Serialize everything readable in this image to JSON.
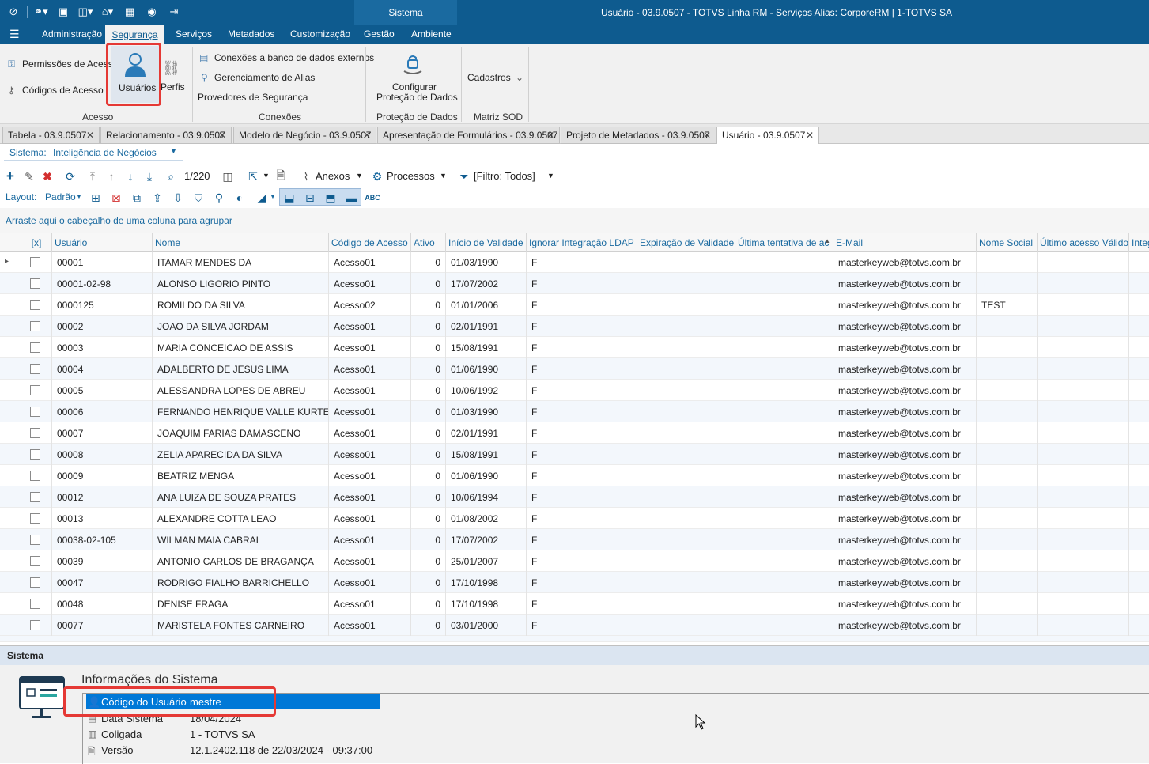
{
  "titlebar": {
    "system_tab": "Sistema",
    "window_title": "Usuário - 03.9.0507 - TOTVS Linha RM - Serviços  Alias: CorporeRM | 1-TOTVS SA"
  },
  "menu": {
    "items": [
      "Administração",
      "Segurança",
      "Serviços",
      "Metadados",
      "Customização",
      "Gestão",
      "Ambiente"
    ],
    "active": "Segurança"
  },
  "ribbon": {
    "permissoes": "Permissões de Acesso",
    "codigos": "Códigos de Acesso",
    "usuarios": "Usuários",
    "perfis": "Perfis",
    "acesso_label": "Acesso",
    "conexoes_bd": "Conexões a banco de dados externos",
    "alias": "Gerenciamento de Alias",
    "provedores": "Provedores de Segurança",
    "conexoes_label": "Conexões",
    "configurar_1": "Configurar",
    "configurar_2": "Proteção de Dados",
    "protecao_label": "Proteção de Dados",
    "cadastros": "Cadastros",
    "matriz_label": "Matriz SOD"
  },
  "doc_tabs": [
    "Tabela - 03.9.0507",
    "Relacionamento - 03.9.0507",
    "Modelo de Negócio - 03.9.0507",
    "Apresentação de Formulários - 03.9.0507",
    "Projeto de Metadados - 03.9.0507",
    "Usuário - 03.9.0507"
  ],
  "sistema": {
    "label": "Sistema:",
    "value": "Inteligência de Negócios"
  },
  "toolbar": {
    "record_count": "1/220",
    "anexos": "Anexos",
    "processos": "Processos",
    "filtro": "[Filtro: Todos]",
    "layout_label": "Layout:",
    "layout_value": "Padrão"
  },
  "group_hint": "Arraste aqui o cabeçalho de uma coluna para agrupar",
  "grid": {
    "headers": [
      "[x]",
      "Usuário",
      "Nome",
      "Código de Acesso",
      "Ativo",
      "Início de Validade",
      "Ignorar Integração LDAP",
      "Expiração de Validade",
      "Última tentativa de ac",
      "E-Mail",
      "Nome Social",
      "Último acesso Válido",
      "Integ"
    ],
    "rows": [
      [
        "00001",
        "ITAMAR MENDES DA",
        "Acesso01",
        "0",
        "01/03/1990",
        "F",
        "masterkeyweb@totvs.com.br",
        ""
      ],
      [
        "00001-02-98",
        "ALONSO LIGORIO PINTO",
        "Acesso01",
        "0",
        "17/07/2002",
        "F",
        "masterkeyweb@totvs.com.br",
        ""
      ],
      [
        "0000125",
        "ROMILDO DA SILVA",
        "Acesso02",
        "0",
        "01/01/2006",
        "F",
        "masterkeyweb@totvs.com.br",
        "TEST"
      ],
      [
        "00002",
        "JOAO DA SILVA JORDAM",
        "Acesso01",
        "0",
        "02/01/1991",
        "F",
        "masterkeyweb@totvs.com.br",
        ""
      ],
      [
        "00003",
        "MARIA CONCEICAO DE ASSIS",
        "Acesso01",
        "0",
        "15/08/1991",
        "F",
        "masterkeyweb@totvs.com.br",
        ""
      ],
      [
        "00004",
        "ADALBERTO DE JESUS LIMA",
        "Acesso01",
        "0",
        "01/06/1990",
        "F",
        "masterkeyweb@totvs.com.br",
        ""
      ],
      [
        "00005",
        "ALESSANDRA LOPES DE ABREU",
        "Acesso01",
        "0",
        "10/06/1992",
        "F",
        "masterkeyweb@totvs.com.br",
        ""
      ],
      [
        "00006",
        "FERNANDO HENRIQUE VALLE KURTEN",
        "Acesso01",
        "0",
        "01/03/1990",
        "F",
        "masterkeyweb@totvs.com.br",
        ""
      ],
      [
        "00007",
        "JOAQUIM FARIAS DAMASCENO",
        "Acesso01",
        "0",
        "02/01/1991",
        "F",
        "masterkeyweb@totvs.com.br",
        ""
      ],
      [
        "00008",
        "ZELIA APARECIDA DA SILVA",
        "Acesso01",
        "0",
        "15/08/1991",
        "F",
        "masterkeyweb@totvs.com.br",
        ""
      ],
      [
        "00009",
        "BEATRIZ MENGA",
        "Acesso01",
        "0",
        "01/06/1990",
        "F",
        "masterkeyweb@totvs.com.br",
        ""
      ],
      [
        "00012",
        "ANA LUIZA  DE SOUZA PRATES",
        "Acesso01",
        "0",
        "10/06/1994",
        "F",
        "masterkeyweb@totvs.com.br",
        ""
      ],
      [
        "00013",
        "ALEXANDRE COTTA LEAO",
        "Acesso01",
        "0",
        "01/08/2002",
        "F",
        "masterkeyweb@totvs.com.br",
        ""
      ],
      [
        "00038-02-105",
        "WILMAN MAIA CABRAL",
        "Acesso01",
        "0",
        "17/07/2002",
        "F",
        "masterkeyweb@totvs.com.br",
        ""
      ],
      [
        "00039",
        "ANTONIO CARLOS DE BRAGANÇA",
        "Acesso01",
        "0",
        "25/01/2007",
        "F",
        "masterkeyweb@totvs.com.br",
        ""
      ],
      [
        "00047",
        "RODRIGO FIALHO BARRICHELLO",
        "Acesso01",
        "0",
        "17/10/1998",
        "F",
        "masterkeyweb@totvs.com.br",
        ""
      ],
      [
        "00048",
        "DENISE FRAGA",
        "Acesso01",
        "0",
        "17/10/1998",
        "F",
        "masterkeyweb@totvs.com.br",
        ""
      ],
      [
        "00077",
        "MARISTELA FONTES CARNEIRO",
        "Acesso01",
        "0",
        "03/01/2000",
        "F",
        "masterkeyweb@totvs.com.br",
        ""
      ]
    ]
  },
  "bottom": {
    "header": "Sistema",
    "title": "Informações do Sistema",
    "codigo_label": "Código do Usuário",
    "codigo_value": "mestre",
    "data_label": "Data Sistema",
    "data_value": "18/04/2024",
    "coligada_label": "Coligada",
    "coligada_value": "1 - TOTVS SA",
    "versao_label": "Versão",
    "versao_value": "12.1.2402.118 de 22/03/2024 - 09:37:00"
  },
  "colors": {
    "brand": "#0e5b8f",
    "highlight": "#e53935",
    "selection": "#0078d7"
  }
}
